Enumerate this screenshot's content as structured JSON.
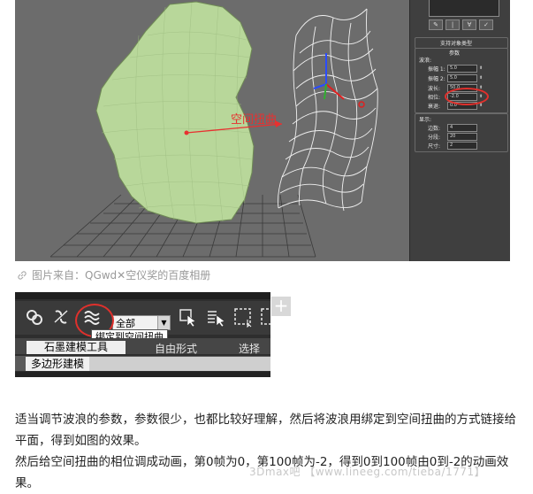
{
  "viewport": {
    "warp_label": "空间扭曲",
    "panel": {
      "section1": "支持对象类型",
      "section2": "参数",
      "group1_title": "波浪:",
      "params": [
        {
          "label": "振幅 1:",
          "value": "5.0"
        },
        {
          "label": "振幅 2:",
          "value": "5.0"
        },
        {
          "label": "波长:",
          "value": "50.0"
        },
        {
          "label": "相位:",
          "value": "-2.0"
        },
        {
          "label": "衰退:",
          "value": "0.0"
        }
      ],
      "group2_title": "显示:",
      "display": [
        {
          "label": "边数:",
          "value": "4"
        },
        {
          "label": "分段:",
          "value": "20"
        },
        {
          "label": "尺寸:",
          "value": "2"
        }
      ]
    }
  },
  "caption": {
    "text": "图片来自：QGwd✕空仪奖的百度相册"
  },
  "toolbar": {
    "select_value": "全部",
    "tooltip": "绑定到空间扭曲",
    "ribbon_tab_active": "石墨建模工具",
    "ribbon_tab2": "自由形式",
    "ribbon_tab3": "选择",
    "sub_tab": "多边形建模"
  },
  "body": {
    "para1": "适当调节波浪的参数，参数很少，也都比较好理解，然后将波浪用绑定到空间扭曲的方式链接给平面，得到如图的效果。",
    "para2": "然后给空间扭曲的相位调成动画，第0帧为0，第100帧为-2，得到0到100帧由0到-2的动画效果。"
  },
  "watermark": "3Dmax吧 【www.lineeg.com/tieba/1771】",
  "colors": {
    "highlight_red": "#e0302c",
    "viewport_bg": "#6c6c6c",
    "object_green": "#b8d79a"
  }
}
